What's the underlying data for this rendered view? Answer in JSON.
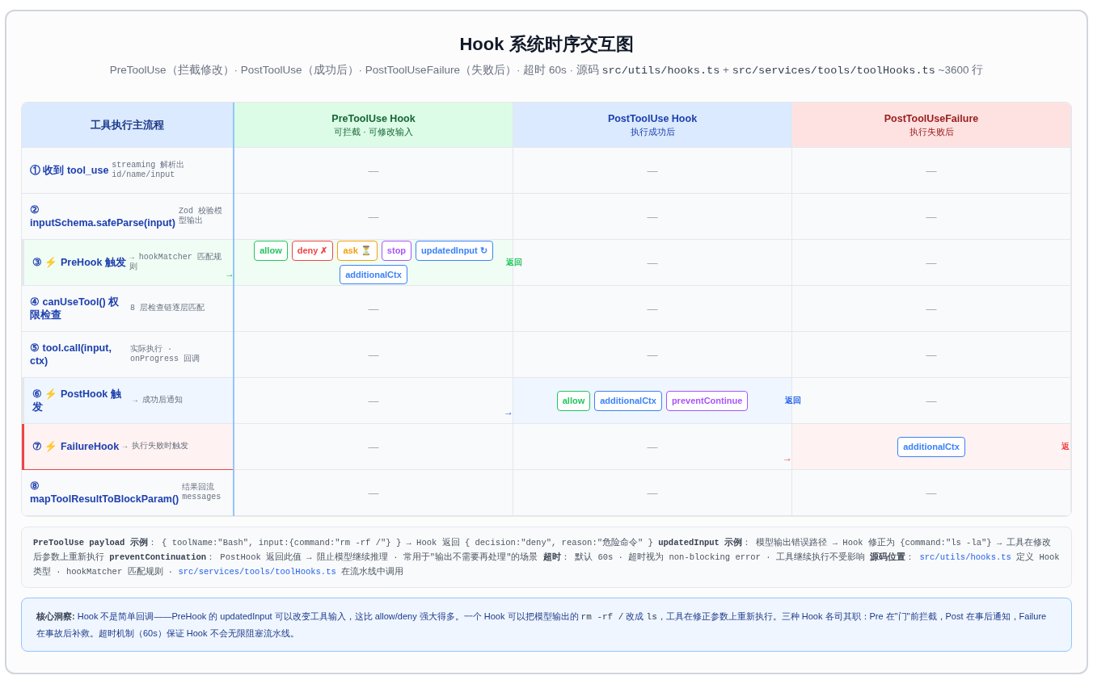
{
  "title": "Hook 系统时序交互图",
  "subtitle": [
    {
      "kind": "text",
      "text": "PreToolUse（拦截修改）· PostToolUse（成功后）· PostToolUseFailure（失败后）· 超时 60s · 源码 "
    },
    {
      "kind": "code",
      "text": "src/utils/hooks.ts"
    },
    {
      "kind": "text",
      "text": " + "
    },
    {
      "kind": "code",
      "text": "src/services/tools/toolHooks.ts"
    },
    {
      "kind": "text",
      "text": " ~3600 行"
    }
  ],
  "flow_header": "工具执行主流程",
  "hooks": [
    {
      "title": "PreToolUse Hook",
      "subtitle": "可拦截 · 可修改输入",
      "kind": "pre"
    },
    {
      "title": "PostToolUse Hook",
      "subtitle": "执行成功后",
      "kind": "post"
    },
    {
      "title": "PostToolUseFailure",
      "subtitle": "执行失败后",
      "kind": "failure"
    }
  ],
  "rows": [
    {
      "step": {
        "label": "① 收到 tool_use",
        "note": "streaming 解析出 id/name/input",
        "kind": "plain"
      },
      "cells": [
        {
          "kind": "dash",
          "text": "—"
        },
        {
          "kind": "dash",
          "text": "—"
        },
        {
          "kind": "dash",
          "text": "—"
        }
      ]
    },
    {
      "step": {
        "label": "② inputSchema.safeParse(input)",
        "note": "Zod 校验模型输出",
        "kind": "plain"
      },
      "cells": [
        {
          "kind": "dash",
          "text": "—"
        },
        {
          "kind": "dash",
          "text": "—"
        },
        {
          "kind": "dash",
          "text": "—"
        }
      ]
    },
    {
      "step": {
        "label": "③ ⚡ PreHook 触发",
        "note": "→ hookMatcher 匹配规则",
        "kind": "pre"
      },
      "cells": [
        {
          "kind": "tags",
          "arrow": "→",
          "return_label": "返回",
          "tags": [
            {
              "label": "allow",
              "color": "#22c55e"
            },
            {
              "label": "deny ✗",
              "color": "#ef4444"
            },
            {
              "label": "ask ⏳",
              "color": "#f59e0b"
            },
            {
              "label": "stop",
              "color": "#a855f7"
            },
            {
              "label": "updatedInput ↻",
              "color": "#3b82f6"
            },
            {
              "label": "additionalCtx",
              "color": "#3b82f6"
            }
          ]
        },
        {
          "kind": "dash",
          "text": "—"
        },
        {
          "kind": "dash",
          "text": "—"
        }
      ]
    },
    {
      "step": {
        "label": "④ canUseTool() 权限检查",
        "note": "8 层检查链逐层匹配",
        "kind": "plain"
      },
      "cells": [
        {
          "kind": "dash",
          "text": "—"
        },
        {
          "kind": "dash",
          "text": "—"
        },
        {
          "kind": "dash",
          "text": "—"
        }
      ]
    },
    {
      "step": {
        "label": "⑤ tool.call(input, ctx)",
        "note": "实际执行 · onProgress 回调",
        "kind": "plain"
      },
      "cells": [
        {
          "kind": "dash",
          "text": "—"
        },
        {
          "kind": "dash",
          "text": "—"
        },
        {
          "kind": "dash",
          "text": "—"
        }
      ]
    },
    {
      "step": {
        "label": "⑥ ⚡ PostHook 触发",
        "note": "→ 成功后通知",
        "kind": "post"
      },
      "cells": [
        {
          "kind": "dash",
          "text": "—"
        },
        {
          "kind": "tags",
          "arrow": "→",
          "return_label": "返回",
          "tags": [
            {
              "label": "allow",
              "color": "#22c55e"
            },
            {
              "label": "additionalCtx",
              "color": "#3b82f6"
            },
            {
              "label": "preventContinue",
              "color": "#a855f7"
            }
          ]
        },
        {
          "kind": "dash",
          "text": "—"
        }
      ]
    },
    {
      "step": {
        "label": "⑦ ⚡ FailureHook",
        "note": "→ 执行失败时触发",
        "kind": "failure"
      },
      "cells": [
        {
          "kind": "dash",
          "text": "—"
        },
        {
          "kind": "dash",
          "text": "—"
        },
        {
          "kind": "tags",
          "arrow": "→",
          "return_label": "返",
          "tags": [
            {
              "label": "additionalCtx",
              "color": "#3b82f6"
            }
          ]
        }
      ]
    },
    {
      "step": {
        "label": "⑧ mapToolResultToBlockParam()",
        "note": "结果回流 messages",
        "kind": "plain"
      },
      "cells": [
        {
          "kind": "dash",
          "text": "—"
        },
        {
          "kind": "dash",
          "text": "—"
        },
        {
          "kind": "dash",
          "text": "—"
        }
      ]
    }
  ],
  "notes": [
    {
      "kind": "bold",
      "text": "PreToolUse payload 示例"
    },
    {
      "kind": "text",
      "text": "： { toolName:\"Bash\", input:{command:\"rm -rf /\"} } → Hook 返回 { decision:\"deny\", reason:\"危险命令\" } "
    },
    {
      "kind": "bold",
      "text": "updatedInput 示例"
    },
    {
      "kind": "text",
      "text": "： 模型输出错误路径 → Hook 修正为 {command:\"ls -la\"} → 工具在修改后参数上重新执行 "
    },
    {
      "kind": "bold",
      "text": "preventContinuation"
    },
    {
      "kind": "text",
      "text": "： PostHook 返回此值 → 阻止模型继续推理 · 常用于\"输出不需要再处理\"的场景 "
    },
    {
      "kind": "bold",
      "text": "超时"
    },
    {
      "kind": "text",
      "text": "： 默认 60s · 超时视为 non-blocking error · 工具继续执行不受影响 "
    },
    {
      "kind": "bold",
      "text": "源码位置"
    },
    {
      "kind": "text",
      "text": "： "
    },
    {
      "kind": "link",
      "text": "src/utils/hooks.ts"
    },
    {
      "kind": "text",
      "text": " 定义 Hook 类型 · hookMatcher 匹配规则 · "
    },
    {
      "kind": "link",
      "text": "src/services/tools/toolHooks.ts"
    },
    {
      "kind": "text",
      "text": " 在流水线中调用"
    }
  ],
  "insight": [
    {
      "kind": "bold",
      "text": "核心洞察:"
    },
    {
      "kind": "text",
      "text": " Hook 不是简单回调——PreHook 的 updatedInput 可以改变工具输入，这比 allow/deny 强大得多。一个 Hook 可以把模型输出的 "
    },
    {
      "kind": "code",
      "text": "rm -rf /"
    },
    {
      "kind": "text",
      "text": " 改成 "
    },
    {
      "kind": "code",
      "text": "ls"
    },
    {
      "kind": "text",
      "text": "，工具在修正参数上重新执行。三种 Hook 各司其职：Pre 在\"门\"前拦截，Post 在事后通知，Failure 在事故后补救。超时机制（60s）保证 Hook 不会无限阻塞流水线。"
    }
  ]
}
